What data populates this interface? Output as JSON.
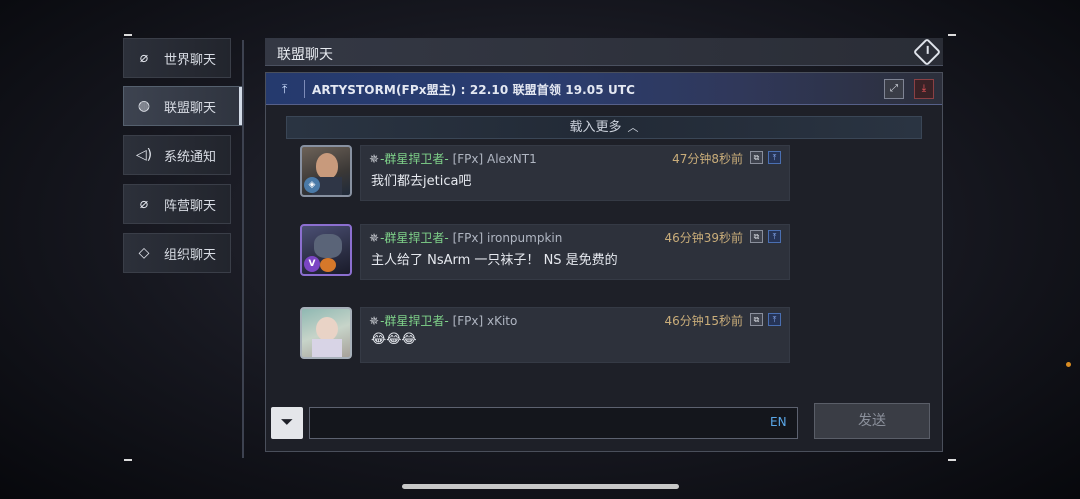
{
  "sidebar": {
    "items": [
      {
        "label": "世界聊天",
        "icon": "globe-ring-icon",
        "glyph": "⌀"
      },
      {
        "label": "联盟聊天",
        "icon": "globe-icon",
        "glyph": "◍"
      },
      {
        "label": "系统通知",
        "icon": "speaker-icon",
        "glyph": "◁)"
      },
      {
        "label": "阵营聊天",
        "icon": "planet-icon",
        "glyph": "⌀"
      },
      {
        "label": "组织聊天",
        "icon": "diamond-link-icon",
        "glyph": "◇"
      }
    ],
    "active_index": 1
  },
  "header": {
    "title": "联盟聊天"
  },
  "pinned": {
    "text": "ARTYSTORM(FPx盟主) : 22.10 联盟首领 19.05 UTC"
  },
  "load_more": {
    "label": "载入更多"
  },
  "messages": [
    {
      "guild": "-群星捍卫者-",
      "user": "[FPx] AlexNT1",
      "time": "47分钟8秒前",
      "text": "我们都去jetica吧",
      "badge": "◈"
    },
    {
      "guild": "-群星捍卫者-",
      "user": "[FPx] ironpumpkin",
      "time": "46分钟39秒前",
      "text": "主人给了 NsArm 一只袜子！ NS 是免费的",
      "badge": "V"
    },
    {
      "guild": "-群星捍卫者-",
      "user": "[FPx] xKito",
      "time": "46分钟15秒前",
      "text": "😂😂😂",
      "badge": ""
    }
  ],
  "input": {
    "value": "",
    "lang": "EN"
  },
  "send": {
    "label": "发送"
  },
  "colors": {
    "accent": "#2a3d70",
    "guild_green": "#7fd38a",
    "time_gold": "#c9ad7a"
  }
}
